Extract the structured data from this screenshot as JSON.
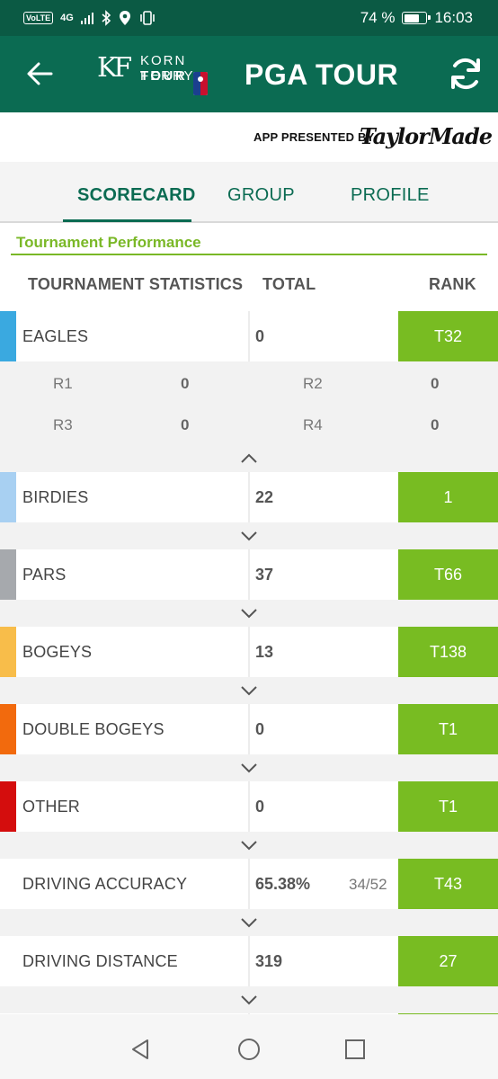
{
  "status_bar": {
    "network": "4G",
    "battery_text": "74 %",
    "battery_level": 0.74,
    "time": "16:03"
  },
  "header": {
    "logo_text_top": "KORN FERRY",
    "logo_text_bottom": "TOUR",
    "title": "PGA TOUR"
  },
  "sponsor": {
    "label": "APP PRESENTED BY",
    "brand": "TaylorMade"
  },
  "tabs": [
    {
      "label": "SCORECARD",
      "active": true
    },
    {
      "label": "GROUP",
      "active": false
    },
    {
      "label": "PROFILE",
      "active": false
    }
  ],
  "section": {
    "title": "Tournament Performance",
    "columns": {
      "stat": "TOURNAMENT STATISTICS",
      "total": "TOTAL",
      "rank": "RANK"
    }
  },
  "stats": [
    {
      "label": "EAGLES",
      "total": "0",
      "sub": "",
      "rank": "T32",
      "color": "#3aa9e0"
    },
    {
      "label": "BIRDIES",
      "total": "22",
      "sub": "",
      "rank": "1",
      "color": "#a8d0f2"
    },
    {
      "label": "PARS",
      "total": "37",
      "sub": "",
      "rank": "T66",
      "color": "#a6a9ad"
    },
    {
      "label": "BOGEYS",
      "total": "13",
      "sub": "",
      "rank": "T138",
      "color": "#f8bd4a"
    },
    {
      "label": "DOUBLE BOGEYS",
      "total": "0",
      "sub": "",
      "rank": "T1",
      "color": "#f26a0d"
    },
    {
      "label": "OTHER",
      "total": "0",
      "sub": "",
      "rank": "T1",
      "color": "#d40d0d"
    },
    {
      "label": "DRIVING ACCURACY",
      "total": "65.38%",
      "sub": "34/52",
      "rank": "T43",
      "color": ""
    },
    {
      "label": "DRIVING DISTANCE",
      "total": "319",
      "sub": "",
      "rank": "27",
      "color": ""
    }
  ],
  "eagles_rounds": [
    {
      "round": "R1",
      "value": "0"
    },
    {
      "round": "R2",
      "value": "0"
    },
    {
      "round": "R3",
      "value": "0"
    },
    {
      "round": "R4",
      "value": "0"
    }
  ],
  "colors": {
    "header_green": "#0b6b52",
    "rank_green": "#78bc22",
    "section_green": "#7ab827"
  }
}
